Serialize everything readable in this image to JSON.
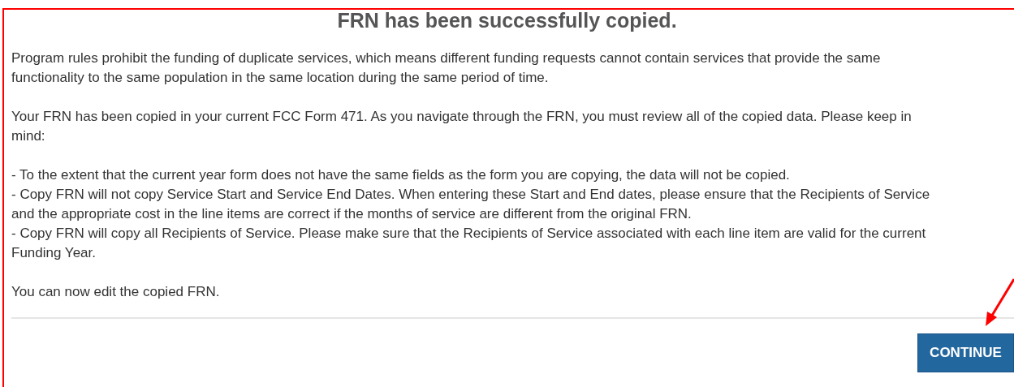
{
  "title": "FRN has been successfully copied.",
  "intro": [
    "Program rules prohibit the funding of duplicate services, which means different funding requests cannot contain services that provide the same",
    "functionality to the same population in the same location during the same period of time."
  ],
  "notice": [
    "Your FRN has been copied in your current FCC Form 471. As you navigate through the FRN, you must review all of the copied data. Please keep in",
    "mind:"
  ],
  "items": [
    {
      "lines": [
        "- To the extent that the current year form does not have the same fields as the form you are copying, the data will not be copied."
      ]
    },
    {
      "lines": [
        "- Copy FRN will not copy Service Start and Service End Dates. When entering these Start and End dates, please ensure that the Recipients of Service",
        "and the appropriate cost in the line items are correct if the months of service are different from the original FRN."
      ]
    },
    {
      "lines": [
        "- Copy FRN will copy all Recipients of Service. Please make sure that the Recipients of Service associated with each line item are valid for the current",
        "Funding Year."
      ]
    }
  ],
  "closing": "You can now edit the copied FRN.",
  "button": "CONTINUE"
}
